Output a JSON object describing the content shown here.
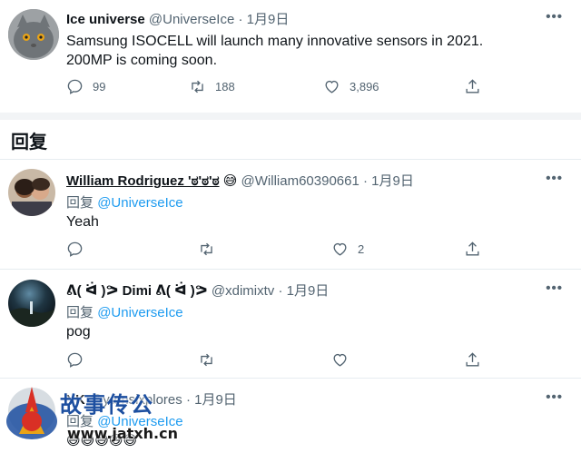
{
  "main_tweet": {
    "name": "Ice universe",
    "handle": "@UniverseIce",
    "date": "1月9日",
    "text_line1": "Samsung ISOCELL will launch many innovative sensors in 2021.",
    "text_line2": "200MP is coming soon.",
    "replies": "99",
    "retweets": "188",
    "likes": "3,896"
  },
  "section": {
    "title": "回复"
  },
  "replies": [
    {
      "name": "William Rodriguez 'ಠ'ಠ'ಠ",
      "emoji": "😅",
      "handle": "@William60390661",
      "date": "1月9日",
      "reply_prefix": "回复",
      "reply_to": "@UniverseIce",
      "text": "Yeah",
      "likes": "2"
    },
    {
      "name": "ᕕ( ᐛ )ᕗ Dimi ᕕ( ᐛ )ᕗ",
      "handle": "@xdimixtv",
      "date": "1月9日",
      "reply_prefix": "回复",
      "reply_to": "@UniverseIce",
      "text": "pog",
      "likes": ""
    },
    {
      "name": "YK",
      "handle": "@yamsixplores",
      "date": "1月9日",
      "reply_prefix": "回复",
      "reply_to": "@UniverseIce",
      "text": "😅😅😅😅😅",
      "likes": ""
    }
  ],
  "sep_dot": "·",
  "more_glyph": "•••",
  "watermark": {
    "text": "故事传公",
    "url": "www.jatxh.cn"
  },
  "colors": {
    "accent": "#1d9bf0",
    "muted": "#536471",
    "separator": "#e6ecf0"
  }
}
